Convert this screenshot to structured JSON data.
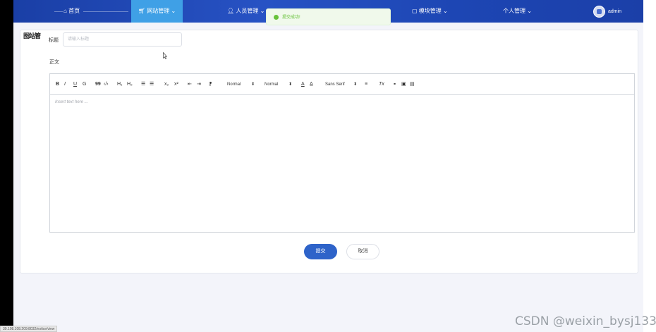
{
  "nav": {
    "items": [
      {
        "label": "首页",
        "icon": "home-icon"
      },
      {
        "label": "网站管理",
        "icon": "cart-icon",
        "chevron": "⌄"
      },
      {
        "label": "人员管理",
        "icon": "user-icon",
        "chevron": "⌄"
      },
      {
        "label": "模块管理",
        "icon": "module-icon",
        "chevron": "⌄"
      },
      {
        "label": "个人管理",
        "chevron": "⌄"
      }
    ],
    "user": "admin"
  },
  "toast": {
    "message": "提交成功!",
    "icon": "success-icon"
  },
  "form": {
    "corner_logo": "图站管",
    "title_label": "标题",
    "title_placeholder": "请输入标题",
    "body_label": "正文",
    "editor_placeholder": "Insert text here ...",
    "toolbar": {
      "bold": "B",
      "italic": "I",
      "underline": "U",
      "strike": "G",
      "blockquote": "99",
      "code": "‹/›",
      "h1": "H₁",
      "h2": "H₂",
      "ordered_list": "☰",
      "bullet_list": "☰",
      "subscript": "x₂",
      "superscript": "x²",
      "indent_left": "⇤",
      "indent_right": "⇥",
      "direction": "⁋",
      "size": "Normal",
      "header": "Normal",
      "font_color": "A",
      "background": "A̲",
      "font": "Sans Serif",
      "align": "≡",
      "clean": "Tx",
      "link": "🔗",
      "image": "▣",
      "video": "▤",
      "caret": "⬍"
    },
    "submit": "提交",
    "cancel": "取消"
  },
  "status_bar": {
    "url": "39.108.108.209:8032/notice/view"
  },
  "watermark": "CSDN @weixin_bysj1330"
}
